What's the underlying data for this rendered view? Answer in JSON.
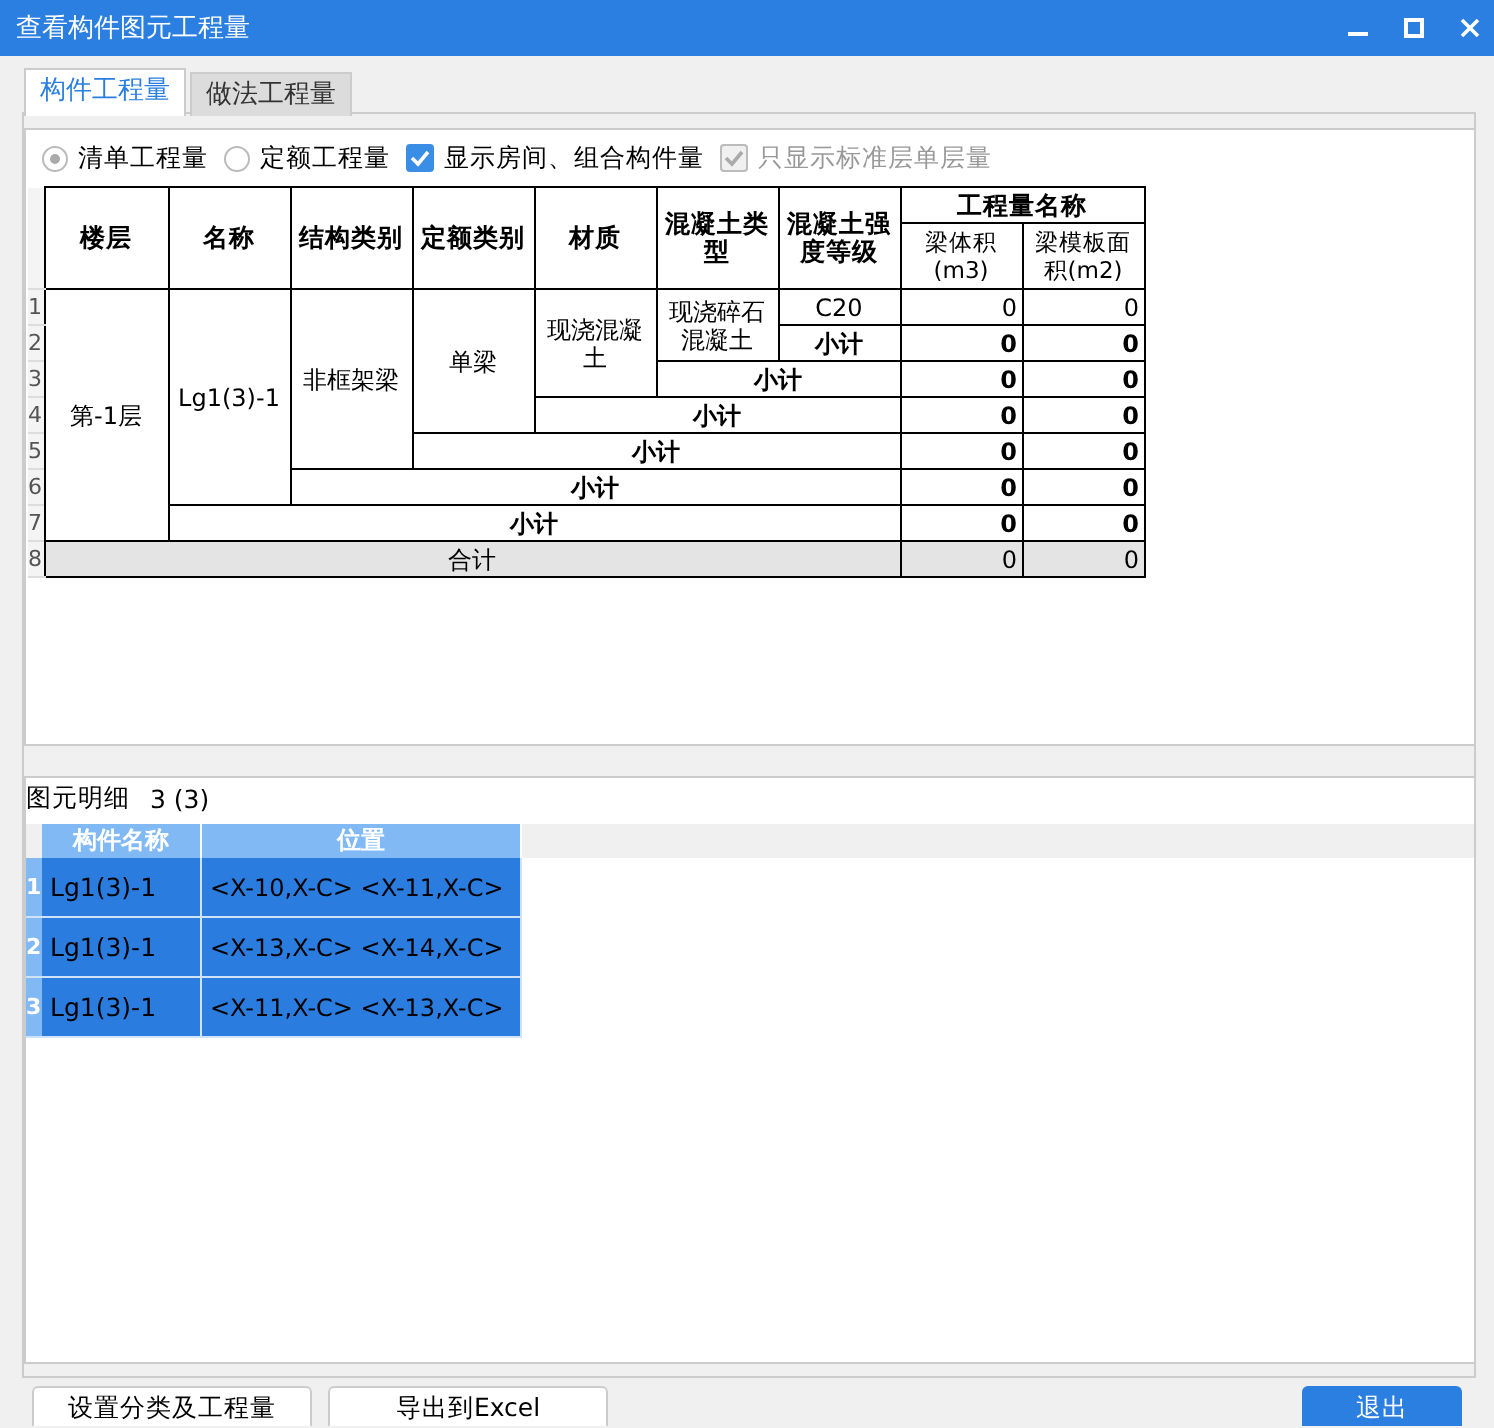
{
  "window": {
    "title": "查看构件图元工程量"
  },
  "tabs": [
    {
      "label": "构件工程量",
      "selected": true
    },
    {
      "label": "做法工程量",
      "selected": false
    }
  ],
  "options": [
    {
      "kind": "radio",
      "label": "清单工程量",
      "selected": true,
      "disabled": false
    },
    {
      "kind": "radio",
      "label": "定额工程量",
      "selected": false,
      "disabled": false
    },
    {
      "kind": "checkbox",
      "label": "显示房间、组合构件量",
      "checked": true,
      "disabled": false
    },
    {
      "kind": "checkbox",
      "label": "只显示标准层单层量",
      "checked": true,
      "disabled": true
    }
  ],
  "quantity_table": {
    "header_rows": [
      [
        {
          "text": "楼层",
          "rowspan": 2,
          "bold": true
        },
        {
          "text": "名称",
          "rowspan": 2,
          "bold": true
        },
        {
          "text": "结构类别",
          "rowspan": 2,
          "bold": true
        },
        {
          "text": "定额类别",
          "rowspan": 2,
          "bold": true
        },
        {
          "text": "材质",
          "rowspan": 2,
          "bold": true
        },
        {
          "text": "混凝土类型",
          "rowspan": 2,
          "bold": true
        },
        {
          "text": "混凝土强度等级",
          "rowspan": 2,
          "bold": true
        },
        {
          "text": "工程量名称",
          "colspan": 2,
          "bold": true
        }
      ],
      [
        {
          "text": "梁体积(m3)",
          "bold": false
        },
        {
          "text": "梁模板面积(m2)",
          "bold": false
        }
      ]
    ],
    "rows": [
      {
        "number": "1",
        "shaded": false,
        "cells": [
          {
            "kind": "text",
            "text": "第-1层",
            "rowspan": 7,
            "bold": false
          },
          {
            "kind": "text",
            "text": "Lg1(3)-1",
            "rowspan": 6,
            "bold": false
          },
          {
            "kind": "text",
            "text": "非框架梁",
            "rowspan": 5,
            "bold": false
          },
          {
            "kind": "text",
            "text": "单梁",
            "rowspan": 4,
            "bold": false
          },
          {
            "kind": "text",
            "text": "现浇混凝土",
            "rowspan": 3,
            "bold": false
          },
          {
            "kind": "text",
            "text": "现浇碎石混凝土",
            "rowspan": 2,
            "bold": false
          },
          {
            "kind": "text",
            "text": "C20",
            "bold": false
          },
          {
            "kind": "number",
            "text": "0",
            "bold": false
          },
          {
            "kind": "number",
            "text": "0",
            "bold": false
          }
        ]
      },
      {
        "number": "2",
        "shaded": false,
        "cells": [
          {
            "kind": "text",
            "text": "小计",
            "bold": true
          },
          {
            "kind": "number",
            "text": "0",
            "bold": true
          },
          {
            "kind": "number",
            "text": "0",
            "bold": true
          }
        ]
      },
      {
        "number": "3",
        "shaded": false,
        "cells": [
          {
            "kind": "text",
            "text": "小计",
            "colspan": 2,
            "bold": true
          },
          {
            "kind": "number",
            "text": "0",
            "bold": true
          },
          {
            "kind": "number",
            "text": "0",
            "bold": true
          }
        ]
      },
      {
        "number": "4",
        "shaded": false,
        "cells": [
          {
            "kind": "text",
            "text": "小计",
            "colspan": 3,
            "bold": true
          },
          {
            "kind": "number",
            "text": "0",
            "bold": true
          },
          {
            "kind": "number",
            "text": "0",
            "bold": true
          }
        ]
      },
      {
        "number": "5",
        "shaded": false,
        "cells": [
          {
            "kind": "text",
            "text": "小计",
            "colspan": 4,
            "bold": true
          },
          {
            "kind": "number",
            "text": "0",
            "bold": true
          },
          {
            "kind": "number",
            "text": "0",
            "bold": true
          }
        ]
      },
      {
        "number": "6",
        "shaded": false,
        "cells": [
          {
            "kind": "text",
            "text": "小计",
            "colspan": 5,
            "bold": true
          },
          {
            "kind": "number",
            "text": "0",
            "bold": true
          },
          {
            "kind": "number",
            "text": "0",
            "bold": true
          }
        ]
      },
      {
        "number": "7",
        "shaded": false,
        "cells": [
          {
            "kind": "text",
            "text": "小计",
            "colspan": 6,
            "bold": true
          },
          {
            "kind": "number",
            "text": "0",
            "bold": true
          },
          {
            "kind": "number",
            "text": "0",
            "bold": true
          }
        ]
      },
      {
        "number": "8",
        "shaded": true,
        "cells": [
          {
            "kind": "text",
            "text": "合计",
            "colspan": 7,
            "bold": false
          },
          {
            "kind": "number",
            "text": "0",
            "bold": false
          },
          {
            "kind": "number",
            "text": "0",
            "bold": false
          }
        ]
      }
    ]
  },
  "detail_panel": {
    "title": "图元明细",
    "count": "3 (3)",
    "columns": [
      "构件名称",
      "位置"
    ],
    "rows": [
      {
        "number": "1",
        "name": "Lg1(3)-1",
        "position": "<X-10,X-C> <X-11,X-C>",
        "selected": true
      },
      {
        "number": "2",
        "name": "Lg1(3)-1",
        "position": "<X-13,X-C> <X-14,X-C>",
        "selected": true
      },
      {
        "number": "3",
        "name": "Lg1(3)-1",
        "position": "<X-11,X-C> <X-13,X-C>",
        "selected": true
      }
    ]
  },
  "buttons": [
    {
      "label": "设置分类及工程量",
      "kind": "default"
    },
    {
      "label": "导出到Excel",
      "kind": "default"
    },
    {
      "label": "退出",
      "kind": "primary"
    }
  ]
}
